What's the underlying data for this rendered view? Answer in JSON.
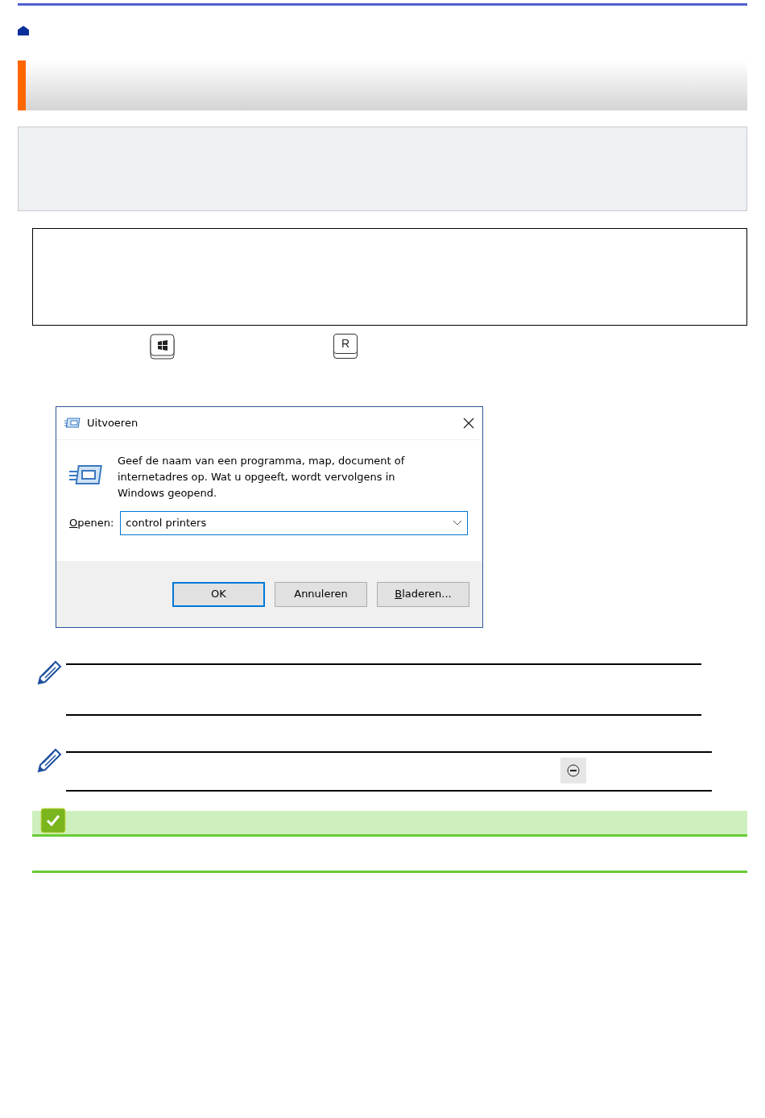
{
  "keys": [
    {
      "kind": "windows"
    },
    {
      "kind": "letter",
      "label": "R"
    }
  ],
  "dialog": {
    "title": "Uitvoeren",
    "message": "Geef de naam van een programma, map, document of internetadres op. Wat u opgeeft, wordt vervolgens in Windows geopend.",
    "open_label": {
      "text": "Openen:",
      "underline_first": true
    },
    "open_value": "control printers",
    "buttons": [
      {
        "label": "OK",
        "default": true,
        "underline_first": false
      },
      {
        "label": "Annuleren",
        "default": false,
        "underline_first": false
      },
      {
        "label": "Bladeren...",
        "default": false,
        "underline_first": true
      }
    ]
  },
  "notes": [
    {
      "kind": "plain"
    },
    {
      "kind": "with_button"
    }
  ]
}
